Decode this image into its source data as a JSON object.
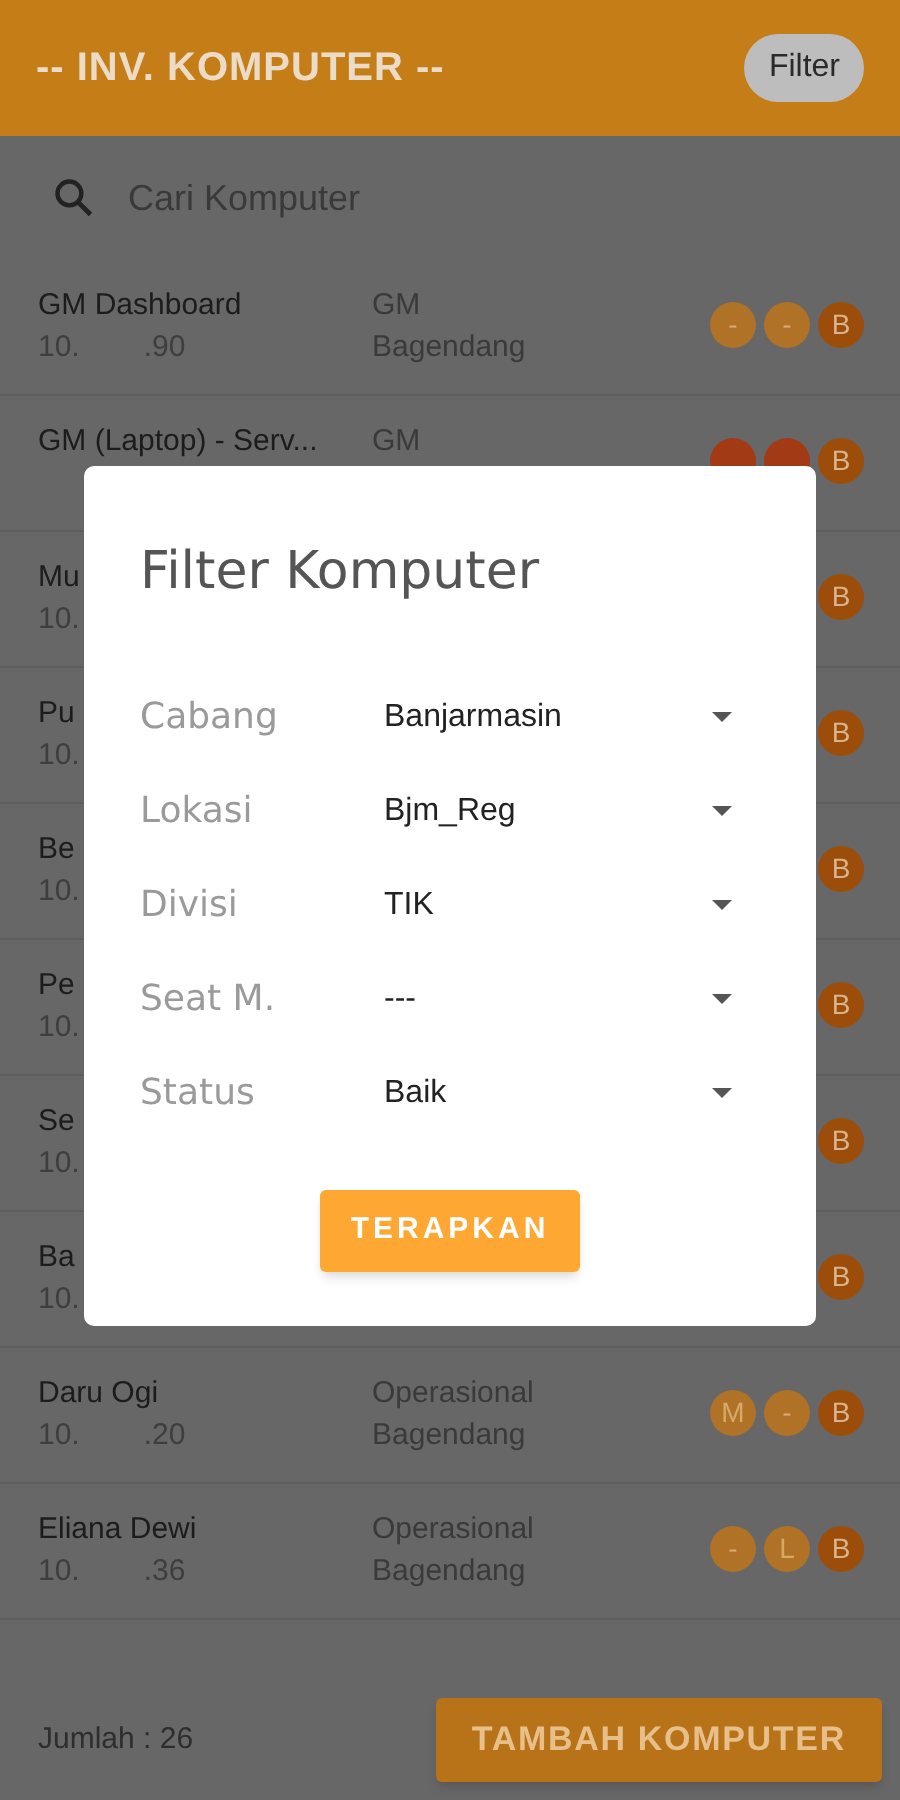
{
  "app_bar": {
    "title": "-- INV. KOMPUTER --",
    "filter_button": "Filter"
  },
  "search": {
    "placeholder": "Cari Komputer"
  },
  "rows": [
    {
      "name": "GM Dashboard",
      "ip_start": "10.",
      "ip_end": ".90",
      "dept": "GM",
      "location": "Bagendang",
      "badges": [
        {
          "label": "-",
          "kind": "light"
        },
        {
          "label": "-",
          "kind": "light"
        },
        {
          "label": "B",
          "kind": "dark"
        }
      ]
    },
    {
      "name": "GM (Laptop) - Serv...",
      "dept": "GM",
      "badges": [
        {
          "kind": "red"
        },
        {
          "kind": "red"
        },
        {
          "label": "B",
          "kind": "dark"
        }
      ]
    },
    {
      "name": "Mu",
      "ip_start": "10.",
      "badges": [
        {
          "label": "B",
          "kind": "dark"
        }
      ]
    },
    {
      "name": "Pu",
      "ip_start": "10.",
      "badges": [
        {
          "label": "B",
          "kind": "dark"
        }
      ]
    },
    {
      "name": "Be",
      "ip_start": "10.",
      "badges": [
        {
          "label": "B",
          "kind": "dark"
        }
      ]
    },
    {
      "name": "Pe",
      "ip_start": "10.",
      "badges": [
        {
          "label": "B",
          "kind": "dark"
        }
      ]
    },
    {
      "name": "Se",
      "ip_start": "10.",
      "badges": [
        {
          "label": "B",
          "kind": "dark"
        }
      ]
    },
    {
      "name": "Ba",
      "ip_start": "10.",
      "badges": [
        {
          "label": "B",
          "kind": "dark"
        }
      ]
    },
    {
      "name": "Daru Ogi",
      "ip_start": "10.",
      "ip_end": ".20",
      "dept": "Operasional",
      "location": "Bagendang",
      "badges": [
        {
          "label": "M",
          "kind": "light"
        },
        {
          "label": "-",
          "kind": "light"
        },
        {
          "label": "B",
          "kind": "dark"
        }
      ]
    },
    {
      "name": "Eliana Dewi",
      "ip_start": "10.",
      "ip_end": ".36",
      "dept": "Operasional",
      "location": "Bagendang",
      "badges": [
        {
          "label": "-",
          "kind": "light"
        },
        {
          "label": "L",
          "kind": "light"
        },
        {
          "label": "B",
          "kind": "dark"
        }
      ]
    }
  ],
  "footer": {
    "count": "Jumlah : 26",
    "add_button": "TAMBAH KOMPUTER"
  },
  "dialog": {
    "title": "Filter Komputer",
    "fields": [
      {
        "label": "Cabang",
        "value": "Banjarmasin"
      },
      {
        "label": "Lokasi",
        "value": "Bjm_Reg"
      },
      {
        "label": "Divisi",
        "value": "TIK"
      },
      {
        "label": "Seat M.",
        "value": "---"
      },
      {
        "label": "Status",
        "value": "Baik"
      }
    ],
    "apply_button": "TERAPKAN"
  }
}
